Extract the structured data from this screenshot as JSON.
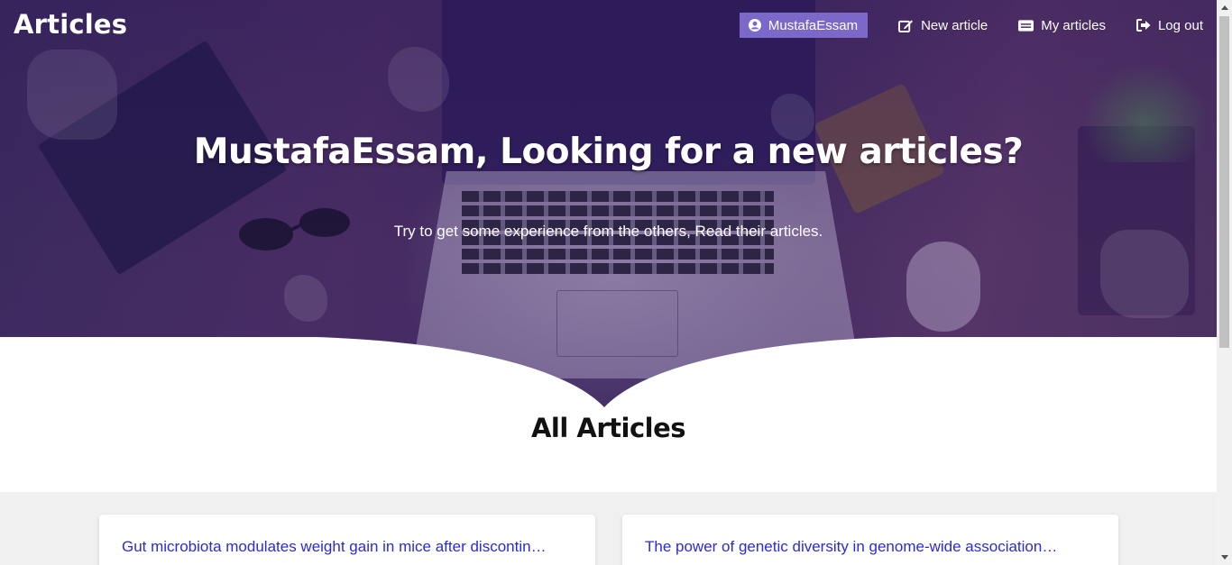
{
  "brand": {
    "title": "Articles"
  },
  "nav": {
    "user_label": "MustafaEssam",
    "new_article_label": "New article",
    "my_articles_label": "My articles",
    "logout_label": "Log out"
  },
  "hero": {
    "title": "MustafaEssam, Looking for a new articles?",
    "subtitle": "Try to get some experience from the others, Read their articles."
  },
  "section": {
    "title": "All Articles"
  },
  "articles": [
    {
      "title": "Gut microbiota modulates weight gain in mice after discontinued smoke exposure"
    },
    {
      "title": "The power of genetic diversity in genome-wide association studies of lipids"
    }
  ],
  "colors": {
    "accent": "#7b68c9",
    "link": "#2b2bd6",
    "hero_overlay": "#3a2c5c",
    "articles_bg": "#f1f0f0"
  },
  "icons": {
    "user": "user-circle-icon",
    "new_article": "edit-icon",
    "my_articles": "id-card-icon",
    "logout": "sign-out-icon"
  }
}
